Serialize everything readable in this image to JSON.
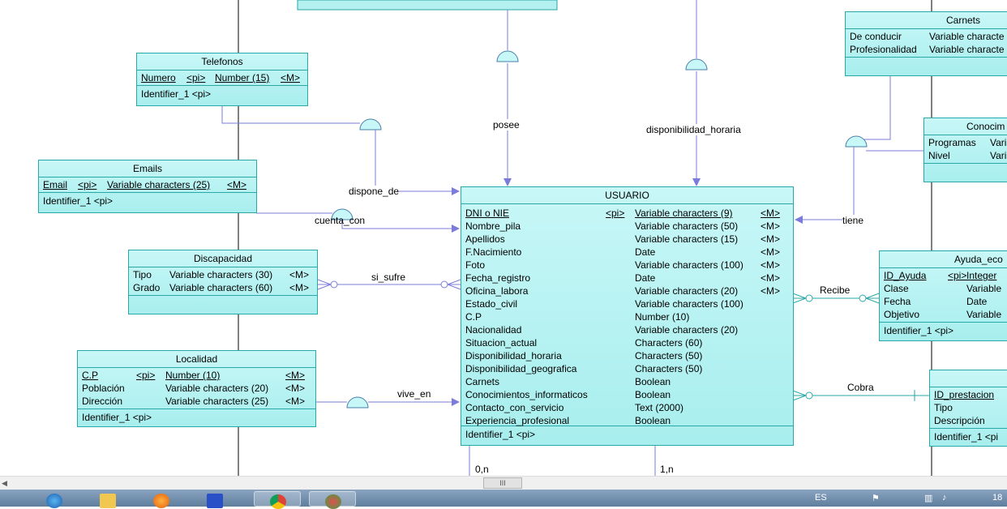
{
  "entities": {
    "telefonos": {
      "title": "Telefonos",
      "rows": [
        {
          "name": "Numero",
          "key": "<pi>",
          "type": "Number (15)",
          "mand": "<M>"
        }
      ],
      "identifier": "Identifier_1   <pi>"
    },
    "emails": {
      "title": "Emails",
      "rows": [
        {
          "name": "Email",
          "key": "<pi>",
          "type": "Variable characters (25)",
          "mand": "<M>"
        }
      ],
      "identifier": "Identifier_1   <pi>"
    },
    "discapacidad": {
      "title": "Discapacidad",
      "rows": [
        {
          "name": "Tipo",
          "type": "Variable characters (30)",
          "mand": "<M>"
        },
        {
          "name": "Grado",
          "type": "Variable characters (60)",
          "mand": "<M>"
        }
      ]
    },
    "localidad": {
      "title": "Localidad",
      "rows": [
        {
          "name": "C.P",
          "key": "<pi>",
          "type": "Number (10)",
          "mand": "<M>"
        },
        {
          "name": "Población",
          "type": "Variable characters (20)",
          "mand": "<M>"
        },
        {
          "name": "Dirección",
          "type": "Variable characters (25)",
          "mand": "<M>"
        }
      ],
      "identifier": "Identifier_1   <pi>"
    },
    "usuario": {
      "title": "USUARIO",
      "rows": [
        {
          "name": "DNI o NIE",
          "key": "<pi>",
          "type": "Variable characters (9)",
          "mand": "<M>"
        },
        {
          "name": "Nombre_pila",
          "type": "Variable characters (50)",
          "mand": "<M>"
        },
        {
          "name": "Apellidos",
          "type": "Variable characters (15)",
          "mand": "<M>"
        },
        {
          "name": "F.Nacimiento",
          "type": "Date",
          "mand": "<M>"
        },
        {
          "name": "Foto",
          "type": "Variable characters (100)",
          "mand": "<M>"
        },
        {
          "name": "Fecha_registro",
          "type": "Date",
          "mand": "<M>"
        },
        {
          "name": "Oficina_labora",
          "type": "Variable characters (20)",
          "mand": "<M>"
        },
        {
          "name": "Estado_civil",
          "type": "Variable characters (100)",
          "mand": ""
        },
        {
          "name": "C.P",
          "type": "Number (10)",
          "mand": ""
        },
        {
          "name": "Nacionalidad",
          "type": "Variable characters (20)",
          "mand": ""
        },
        {
          "name": "Situacion_actual",
          "type": "Characters (60)",
          "mand": ""
        },
        {
          "name": "Disponibilidad_horaria",
          "type": "Characters (50)",
          "mand": ""
        },
        {
          "name": "Disponibilidad_geografica",
          "type": "Characters (50)",
          "mand": ""
        },
        {
          "name": "Carnets",
          "type": "Boolean",
          "mand": ""
        },
        {
          "name": "Conocimientos_informaticos",
          "type": "Boolean",
          "mand": ""
        },
        {
          "name": "Contacto_con_servicio",
          "type": "Text (2000)",
          "mand": ""
        },
        {
          "name": "Experiencia_profesional",
          "type": "Boolean",
          "mand": ""
        }
      ],
      "identifier": "Identifier_1   <pi>"
    },
    "carnets": {
      "title": "Carnets",
      "rows": [
        {
          "name": "De conducir",
          "type": "Variable characte"
        },
        {
          "name": "Profesionalidad",
          "type": "Variable characte"
        }
      ]
    },
    "conocimientos": {
      "title": "Conocim",
      "rows": [
        {
          "name": "Programas",
          "type": "Varia"
        },
        {
          "name": "Nivel",
          "type": "Varia"
        }
      ]
    },
    "ayuda": {
      "title": "Ayuda_eco",
      "rows": [
        {
          "name": "ID_Ayuda",
          "key": "<pi>",
          "type": "Integer"
        },
        {
          "name": "Clase",
          "type": "Variable"
        },
        {
          "name": "Fecha",
          "type": "Date"
        },
        {
          "name": "Objetivo",
          "type": "Variable"
        }
      ],
      "identifier": "Identifier_1   <pi>"
    },
    "prestacion": {
      "title": "",
      "rows": [
        {
          "name": "ID_prestacion",
          "type": "<"
        },
        {
          "name": "Tipo",
          "type": ""
        },
        {
          "name": "Descripción",
          "type": ""
        }
      ],
      "identifier": "Identifier_1   <pi"
    }
  },
  "relationships": {
    "posee": "posee",
    "disponibilidad_horaria": "disponibilidad_horaria",
    "dispone_de": "dispone_de",
    "cuenta_con": "cuenta_con",
    "si_sufre": "si_sufre",
    "vive_en": "vive_en",
    "tiene": "tiene",
    "recibe": "Recibe",
    "cobra": "Cobra"
  },
  "cardinalities": {
    "left": "0,n",
    "right": "1,n"
  },
  "colors": {
    "entity_fill": "#b4f0f0",
    "entity_border": "#2aa7a7",
    "link": "#7b7bdc",
    "teal_link": "#2aa7a7"
  },
  "scrollbar": {
    "thumb_label": "III"
  },
  "taskbar": {
    "apps": [
      "internet-explorer-icon",
      "folder-icon",
      "media-player-icon",
      "powerdesigner-icon",
      "chrome-icon",
      "paint-icon"
    ],
    "tray_text": "ES",
    "clock": "18"
  }
}
